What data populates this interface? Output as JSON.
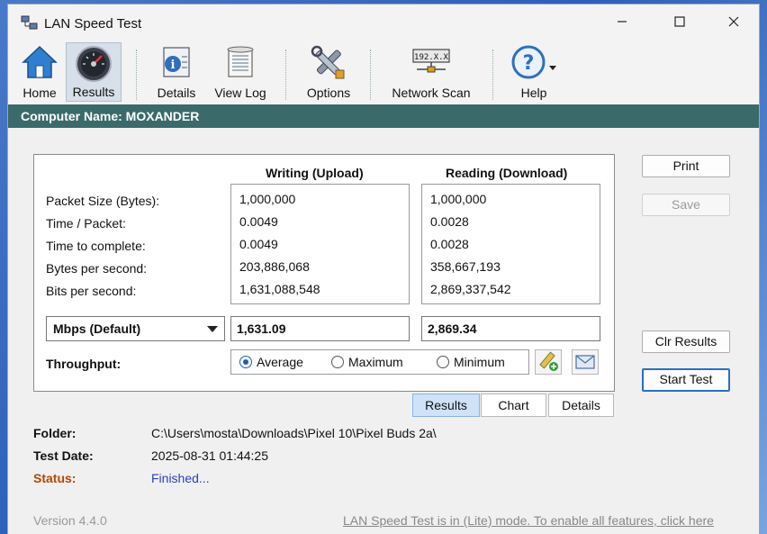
{
  "window": {
    "title": "LAN Speed Test"
  },
  "toolbar": {
    "home": "Home",
    "results": "Results",
    "details": "Details",
    "view_log": "View Log",
    "options": "Options",
    "network_scan": "Network Scan",
    "help": "Help",
    "network_scan_icon_text": "192.X.X"
  },
  "computer": {
    "label": "Computer Name: MOXANDER"
  },
  "results_table": {
    "col_upload": "Writing (Upload)",
    "col_download": "Reading (Download)",
    "rows": [
      {
        "label": "Packet Size (Bytes):",
        "upload": "1,000,000",
        "download": "1,000,000"
      },
      {
        "label": "Time / Packet:",
        "upload": "0.0049",
        "download": "0.0028"
      },
      {
        "label": "Time to complete:",
        "upload": "0.0049",
        "download": "0.0028"
      },
      {
        "label": "Bytes per second:",
        "upload": "203,886,068",
        "download": "358,667,193"
      },
      {
        "label": "Bits per second:",
        "upload": "1,631,088,548",
        "download": "2,869,337,542"
      }
    ],
    "units_selected": "Mbps (Default)",
    "upload_result": "1,631.09",
    "download_result": "2,869.34"
  },
  "throughput": {
    "label": "Throughput:",
    "options": [
      "Average",
      "Maximum",
      "Minimum"
    ],
    "selected": "Average"
  },
  "buttons": {
    "print": "Print",
    "save": "Save",
    "clr_results": "Clr Results",
    "start_test": "Start Test"
  },
  "tabs": [
    "Results",
    "Chart",
    "Details"
  ],
  "info": {
    "folder_label": "Folder:",
    "folder_value": "C:\\Users\\mosta\\Downloads\\Pixel 10\\Pixel Buds 2a\\",
    "date_label": "Test Date:",
    "date_value": "2025-08-31 01:44:25",
    "status_label": "Status:",
    "status_value": "Finished..."
  },
  "footer": {
    "version": "Version 4.4.0",
    "lite_notice": "LAN Speed Test is in (Lite) mode.  To enable all features, click here"
  }
}
